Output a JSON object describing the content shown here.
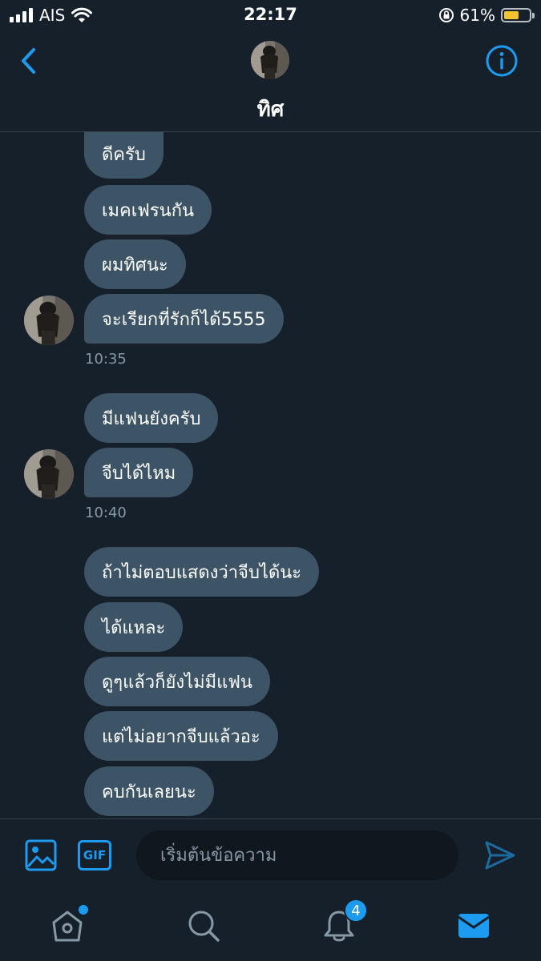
{
  "status_bar": {
    "carrier": "AIS",
    "time": "22:17",
    "battery_percent": "61%",
    "battery_level": 0.61,
    "icons": [
      "signal-icon",
      "wifi-icon",
      "orientation-lock-icon",
      "battery-icon"
    ]
  },
  "header": {
    "name": "ทิศ",
    "back_icon": "chevron-left-icon",
    "info_icon": "info-icon"
  },
  "messages": {
    "group1": [
      "ดีครับ",
      "เมคเฟรนกัน",
      "ผมทิศนะ",
      "จะเรียกที่รักก็ได้5555"
    ],
    "time1": "10:35",
    "group2": [
      "มีแฟนยังครับ",
      "จีบได้ไหม"
    ],
    "time2": "10:40",
    "group3": [
      "ถ้าไม่ตอบแสดงว่าจีบได้นะ",
      "ได้แหละ",
      "ดูๆแล้วก็ยังไม่มีแฟน",
      "แต่ไม่อยากจีบแล้วอะ",
      "คบกันเลยนะ"
    ]
  },
  "compose": {
    "gif_label": "GIF",
    "placeholder": "เริ่มต้นข้อความ"
  },
  "tabbar": {
    "notifications_count": "4"
  },
  "colors": {
    "background": "#15202b",
    "bubble": "#3d5466",
    "accent": "#1d9bf0",
    "muted_text": "#8899a6",
    "battery": "#f2c230"
  }
}
